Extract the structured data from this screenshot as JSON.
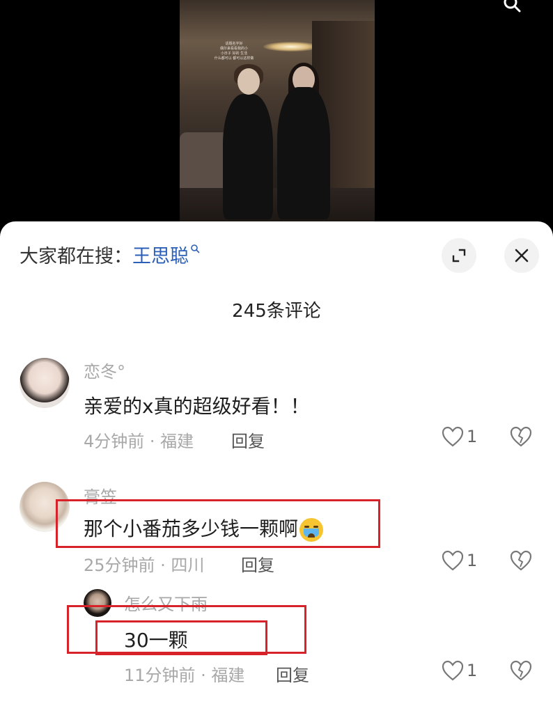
{
  "video": {
    "overlay_text": "话题名字好\n偶尔来看看我的小\n小日子 好的 生活\n什么都可以 都可以这样做"
  },
  "search_hint": {
    "prefix": "大家都在搜：",
    "keyword": "王思聪"
  },
  "comments_header": {
    "count_title": "245条评论"
  },
  "comments": [
    {
      "username": "恋冬°",
      "text": "亲爱的x真的超级好看！！",
      "meta": "4分钟前 · 福建",
      "reply_label": "回复",
      "likes": "1"
    },
    {
      "username": "膏笠",
      "text": "那个小番茄多少钱一颗啊",
      "emoji": "crying-face",
      "meta": "25分钟前 · 四川",
      "reply_label": "回复",
      "likes": "1"
    }
  ],
  "replies": [
    {
      "username": "怎么又下雨",
      "text": "30一颗",
      "meta": "11分钟前 · 福建",
      "reply_label": "回复",
      "likes": "1"
    }
  ],
  "colors": {
    "keyword": "#2b5fb8",
    "highlight_box": "#d8222a",
    "meta_text": "#a8a8a8"
  },
  "icons": [
    "search-icon",
    "expand-icon",
    "close-icon",
    "heart-icon",
    "broken-heart-icon",
    "crying-emoji"
  ]
}
